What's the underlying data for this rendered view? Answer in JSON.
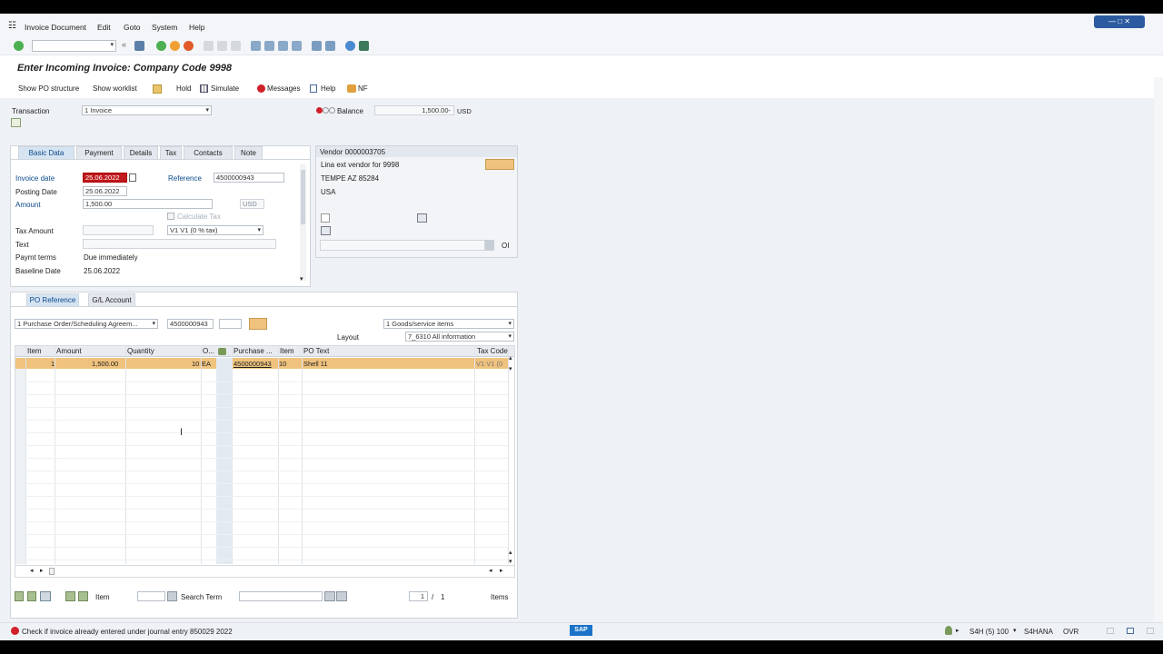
{
  "menu": {
    "items": [
      "Invoice Document",
      "Edit",
      "Goto",
      "System",
      "Help"
    ]
  },
  "title": "Enter Incoming Invoice: Company Code 9998",
  "appbar": {
    "show_po_structure": "Show PO structure",
    "show_worklist": "Show worklist",
    "hold": "Hold",
    "simulate": "Simulate",
    "messages": "Messages",
    "help": "Help",
    "nf": "NF"
  },
  "header": {
    "transaction_label": "Transaction",
    "transaction_value": "1 Invoice",
    "balance_label": "Balance",
    "balance_value": "1,500.00-",
    "balance_currency": "USD"
  },
  "tabs": [
    "Basic Data",
    "Payment",
    "Details",
    "Tax",
    "Contacts",
    "Note"
  ],
  "basic": {
    "invoice_date_label": "Invoice date",
    "invoice_date": "25.06.2022",
    "reference_label": "Reference",
    "reference": "4500000943",
    "posting_date_label": "Posting Date",
    "posting_date": "25.06.2022",
    "amount_label": "Amount",
    "amount": "1,500.00",
    "currency": "USD",
    "calc_tax_label": "Calculate Tax",
    "tax_amount_label": "Tax Amount",
    "tax_code": "V1 V1 (0 % tax)",
    "text_label": "Text",
    "paymt_terms_label": "Paymt terms",
    "paymt_terms": "Due immediately",
    "baseline_label": "Baseline Date",
    "baseline_date": "25.06.2022"
  },
  "vendor": {
    "title": "Vendor 0000003705",
    "line1": "Lina ext vendor for 9998",
    "line2": "TEMPE AZ  85284",
    "line3": "USA",
    "oi": "OI"
  },
  "ref_tabs": [
    "PO Reference",
    "G/L Account"
  ],
  "po": {
    "ref_type": "1 Purchase Order/Scheduling Agreem...",
    "po_number": "4500000943",
    "items_type": "1 Goods/service items",
    "layout_label": "Layout",
    "layout_value": "7_6310 All information"
  },
  "grid": {
    "headers": [
      "Item",
      "Amount",
      "Quantity",
      "O...",
      "Purchase ...",
      "Item",
      "PO Text",
      "Tax Code"
    ],
    "rows": [
      {
        "item": "1",
        "amount": "1,500.00",
        "quantity": "10",
        "unit": "EA",
        "po": "4500000943",
        "po_item": "10",
        "text": "Shell 11",
        "tax": "V1 V1 (0"
      }
    ]
  },
  "footer": {
    "item_label": "Item",
    "search_label": "Search Term",
    "page_current": "1",
    "page_sep": "/",
    "page_total": "1",
    "items_label": "Items"
  },
  "status": {
    "message": "Check if invoice already entered under journal entry 850029 2022",
    "logo": "SAP",
    "system": "S4H (5) 100",
    "server": "S4HANA",
    "mode": "OVR"
  },
  "colors": {
    "accent": "#0a4a8a",
    "error": "#c0191e",
    "selected_row": "#efc27d"
  }
}
